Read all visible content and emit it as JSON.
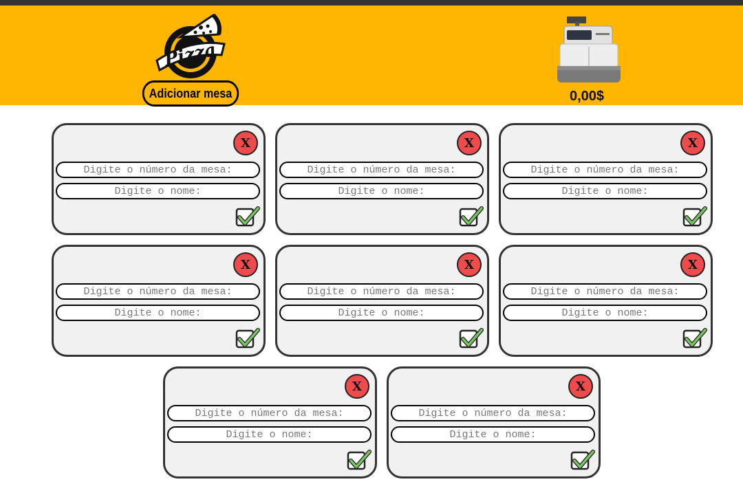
{
  "header": {
    "logo_text": "Pizza",
    "add_table_label": "Adicionar mesa",
    "total": "0,00$",
    "brand_color": "#FFB600"
  },
  "cards": {
    "close_label": "X",
    "number_placeholder": "Digite o número da mesa:",
    "name_placeholder": "Digite o nome:",
    "count": 8,
    "close_color": "#EF4B4C",
    "card_bg": "#F0F1F0"
  }
}
